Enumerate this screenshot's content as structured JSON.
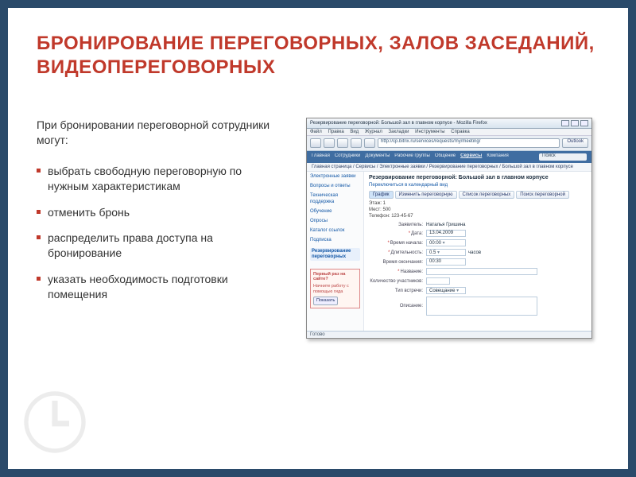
{
  "title": "БРОНИРОВАНИЕ ПЕРЕГОВОРНЫХ, ЗАЛОВ ЗАСЕДАНИЙ, ВИДЕОПЕРЕГОВОРНЫХ",
  "intro": "При бронировании переговорной сотрудники могут:",
  "bullets": [
    "выбрать свободную переговорную по нужным характеристикам",
    "отменить бронь",
    "распределить права доступа на бронирование",
    "указать необходимость подготовки помещения"
  ],
  "shot": {
    "window_title": "Резервирование переговорной: Большой зал в главном корпусе - Mozilla Firefox",
    "menu": [
      "Файл",
      "Правка",
      "Вид",
      "Журнал",
      "Закладки",
      "Инструменты",
      "Справка"
    ],
    "address": "http://cp.bitrix.ru/services/requests/my/meeting/",
    "outlook": "Outlook",
    "nav": [
      "Главная",
      "Сотрудники",
      "Документы",
      "Рабочие группы",
      "Общение",
      "Сервисы",
      "Компания"
    ],
    "nav_active": "Сервисы",
    "search_label": "Поиск",
    "breadcrumb": "Главная страница / Сервисы / Электронные заявки / Резервирование переговорных / Большой зал в главном корпусе",
    "side": {
      "items": [
        "Электронные заявки",
        "Вопросы и ответы",
        "Техническая поддержка",
        "Обучение",
        "Опросы",
        "Каталог ссылок",
        "Подписка"
      ],
      "highlight": "Резервирование переговорных",
      "firstbox_title": "Первый раз на сайте?",
      "firstbox_text": "Начните работу с помощью гида",
      "firstbox_btn": "Показать"
    },
    "main": {
      "heading": "Резервирование переговорной: Большой зал в главном корпусе",
      "calendar_link": "Переключиться в календарный вид",
      "tabs": [
        "График",
        "Изменить переговорную",
        "Список переговорных",
        "Поиск переговорной"
      ],
      "info_floor": "Этаж: 1",
      "info_seats": "Мест: 500",
      "info_phone": "Телефон: 123-45-67",
      "author_label": "Заявитель:",
      "author": "Наталья Гришина",
      "fields": {
        "date_label": "Дата:",
        "date": "13.04.2009",
        "start_label": "Время начала:",
        "start": "00:00",
        "dur_label": "Длительность:",
        "dur": "0.5",
        "dur_unit": "часов",
        "end_label": "Время окончания:",
        "end": "00:30",
        "name_label": "Название:",
        "name": "",
        "count_label": "Количество участников:",
        "count": "",
        "type_label": "Тип встречи:",
        "type": "Совещание",
        "desc_label": "Описание:"
      }
    },
    "status": "Готово"
  }
}
